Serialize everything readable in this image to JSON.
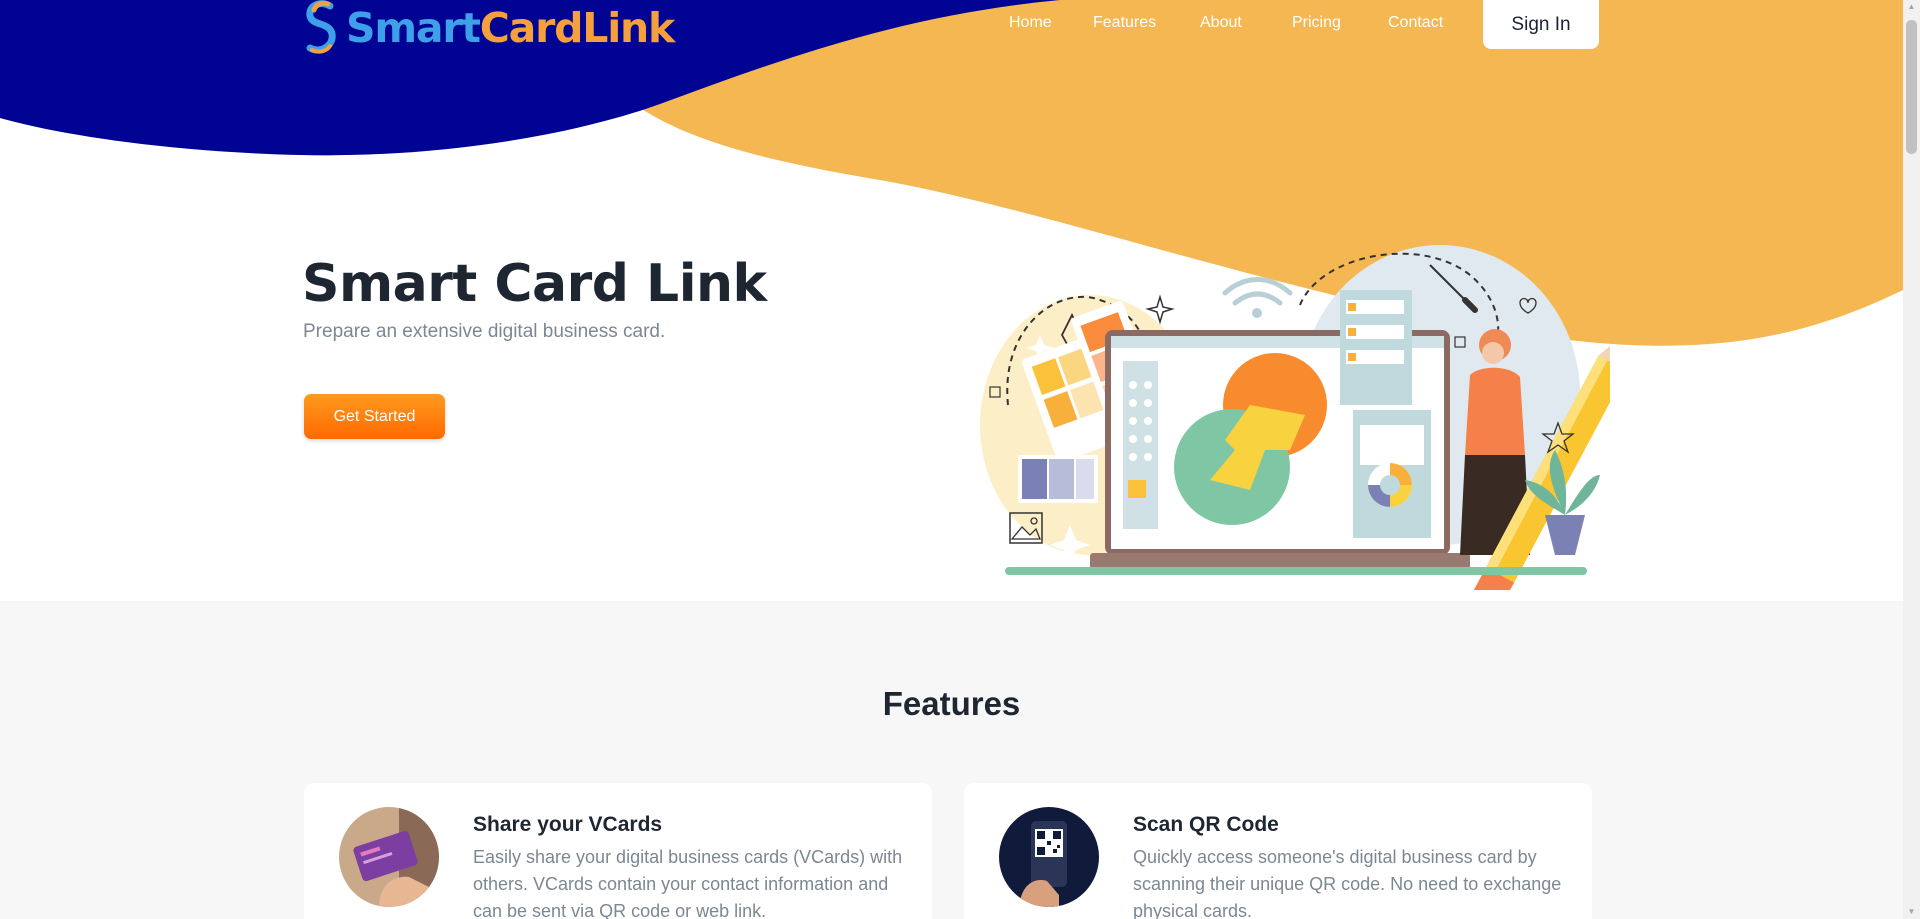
{
  "brand": {
    "name_part1": "Smart",
    "name_part2": "Card",
    "name_part3": "Link",
    "primary_color": "#010392",
    "accent_color": "#f4b752"
  },
  "nav": {
    "items": [
      "Home",
      "Features",
      "About",
      "Pricing",
      "Contact"
    ],
    "signin_label": "Sign In"
  },
  "hero": {
    "title": "Smart Card Link",
    "subtitle": "Prepare an extensive digital business card.",
    "cta_label": "Get Started"
  },
  "features": {
    "title": "Features",
    "cards": [
      {
        "title": "Share your VCards",
        "text": "Easily share your digital business cards (VCards) with others. VCards contain your contact information and can be sent via QR code or web link.",
        "icon": "hand-holding-card-image"
      },
      {
        "title": "Scan QR Code",
        "text": "Quickly access someone's digital business card by scanning their unique QR code. No need to exchange physical cards.",
        "icon": "phone-qr-scan-image"
      }
    ]
  }
}
